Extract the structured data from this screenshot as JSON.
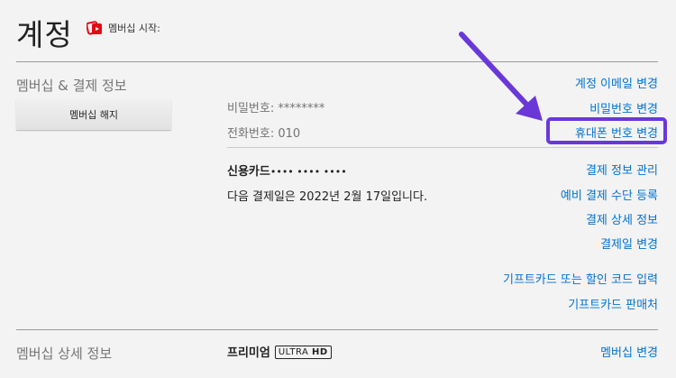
{
  "page": {
    "title": "계정",
    "member_since_label": "멤버십 시작:"
  },
  "membership_billing": {
    "section_label": "멤버십 & 결제 정보",
    "cancel_button": "멤버십 해지",
    "password_row": "비밀번호: ********",
    "phone_row": "전화번호: 010",
    "links": {
      "change_email": "계정 이메일 변경",
      "change_password": "비밀번호 변경",
      "change_phone": "휴대폰 번호 변경",
      "manage_payment": "결제 정보 관리",
      "add_backup_payment": "예비 결제 수단 등록",
      "billing_details": "결제 상세 정보",
      "change_billing_day": "결제일 변경",
      "redeem_gift": "기프트카드 또는 할인 코드 입력",
      "gift_retailers": "기프트카드 판매처"
    },
    "card_label": "신용카드",
    "card_mask": "•••• •••• ••••",
    "next_billing": "다음 결제일은 2022년 2월 17일입니다."
  },
  "plan": {
    "section_label": "멤버십 상세 정보",
    "plan_name": "프리미엄",
    "badge_ultra": "ULTRA",
    "badge_hd": "HD",
    "change_plan": "멤버십 변경"
  },
  "colors": {
    "link": "#0073d4",
    "highlight": "#6a38d8",
    "brand_icon": "#e50914"
  },
  "icons": {
    "member_since": "membership-badge-icon",
    "annotation_arrow": "arrow-annotation"
  }
}
